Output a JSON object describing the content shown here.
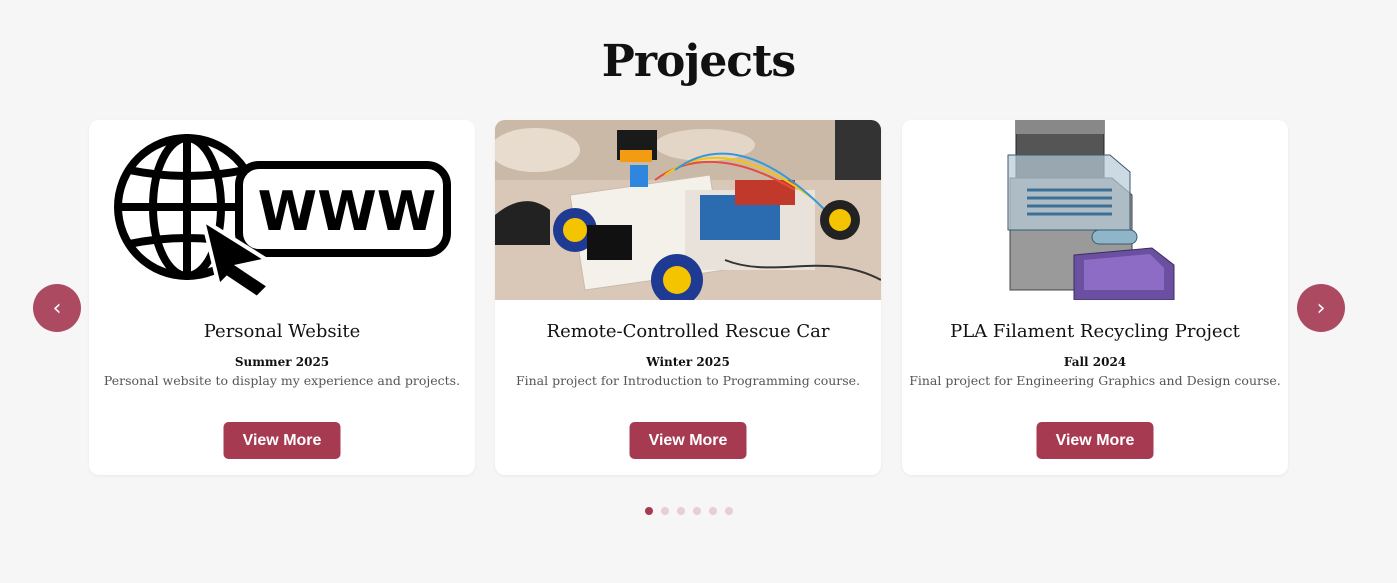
{
  "section": {
    "title": "Projects"
  },
  "carousel": {
    "prev_label": "‹",
    "next_label": "›",
    "dots_total": 6,
    "active_dot": 1
  },
  "cards": [
    {
      "title": "Personal Website",
      "date": "Summer 2025",
      "description": "Personal website to display my experience and projects.",
      "button": "View More",
      "image_logo_text": "WWW",
      "image": "globe-www-cursor-icon"
    },
    {
      "title": "Remote-Controlled Rescue Car",
      "date": "Winter 2025",
      "description": "Final project for Introduction to Programming course.",
      "button": "View More",
      "image": "robot-car-photo"
    },
    {
      "title": "PLA Filament Recycling Project",
      "date": "Fall 2024",
      "description": "Final project for Engineering Graphics and Design course.",
      "button": "View More",
      "image": "filament-recycler-cad-render"
    }
  ],
  "colors": {
    "accent": "#a63a50",
    "arrow": "#ab4a60",
    "dot_inactive": "#e8cdd3",
    "background": "#f6f6f6"
  }
}
